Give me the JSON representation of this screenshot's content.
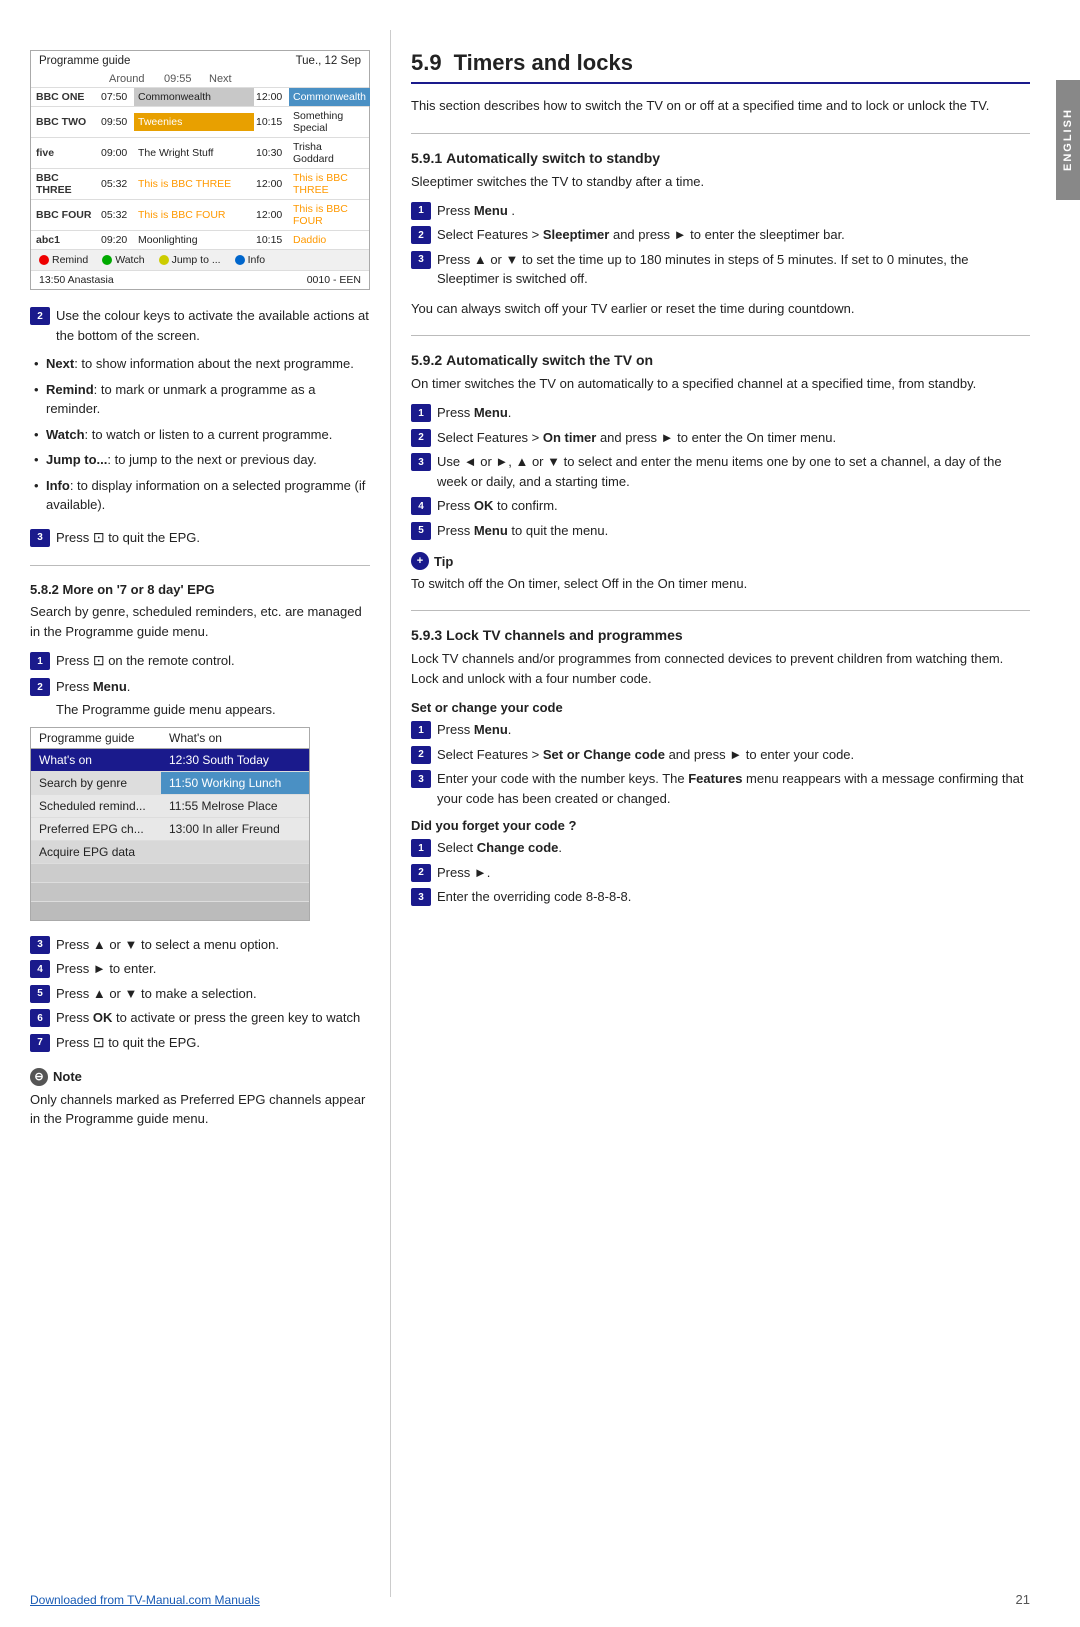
{
  "side_tab": "ENGLISH",
  "left": {
    "prog_table": {
      "title": "Programme guide",
      "date": "Tue., 12 Sep",
      "col_around": "Around",
      "col_time": "09:55",
      "col_next": "Next",
      "rows": [
        {
          "channel": "BBC ONE",
          "time1": "07:50",
          "prog1": "Commonwealth",
          "time2": "12:00",
          "prog2": "Commonwealth",
          "style": "bbc1 bbc2"
        },
        {
          "channel": "BBC TWO",
          "time1": "09:50",
          "prog1": "Tweenies",
          "time2": "10:15",
          "prog2": "Something Special",
          "style": "orange1 blue2"
        },
        {
          "channel": "five",
          "time1": "09:00",
          "prog1": "The Wright Stuff",
          "time2": "10:30",
          "prog2": "Trisha Goddard",
          "style": ""
        },
        {
          "channel": "BBC THREE",
          "time1": "05:32",
          "prog1": "This is BBC THREE",
          "time2": "12:00",
          "prog2": "This is BBC THREE",
          "style": "orange-text"
        },
        {
          "channel": "BBC FOUR",
          "time1": "05:32",
          "prog1": "This is BBC FOUR",
          "time2": "12:00",
          "prog2": "This is BBC FOUR",
          "style": "orange-text"
        },
        {
          "channel": "abc1",
          "time1": "09:20",
          "prog1": "Moonlighting",
          "time2": "10:15",
          "prog2": "Daddio",
          "style": "abc-text"
        }
      ],
      "footer_items": [
        "Remind",
        "Watch",
        "Jump to ...",
        "Info"
      ],
      "footer_left": "13:50  Anastasia",
      "footer_right": "0010 - EEN"
    },
    "step2_text": "Use the colour keys to activate the available actions at the bottom of the screen.",
    "bullets": [
      {
        "label": "Next",
        "text": ": to show information about the next programme."
      },
      {
        "label": "Remind",
        "text": ": to mark or unmark a programme as a reminder."
      },
      {
        "label": "Watch",
        "text": ": to watch or listen to a current programme."
      },
      {
        "label": "Jump to...",
        "text": ": to jump to the next or previous day."
      },
      {
        "label": "Info",
        "text": ": to display information on a selected programme (if available)."
      }
    ],
    "step3_text": "Press ",
    "step3_icon": "⊡",
    "step3_suffix": " to quit the EPG.",
    "subsec_title": "5.8.2    More on '7 or 8 day' EPG",
    "subsec_intro": "Search by genre, scheduled reminders, etc. are managed in the Programme guide menu.",
    "sub_step1": "Press ",
    "sub_step1_icon": "⊡",
    "sub_step1_suffix": " on the remote control.",
    "sub_step2": "Press ",
    "sub_step2_bold": "Menu",
    "sub_step2_suffix": ".",
    "sub_step2_sub": "The Programme guide menu appears.",
    "menu_table": {
      "col1": "Programme guide",
      "col2": "What's on",
      "rows": [
        {
          "col1": "What's on",
          "col2": "12:30 South Today",
          "style": "selected"
        },
        {
          "col1": "Search by genre",
          "col2": "11:50 Working Lunch",
          "style": "highlighted"
        },
        {
          "col1": "Scheduled remind...",
          "col2": "11:55 Melrose Place",
          "style": "plain"
        },
        {
          "col1": "Preferred EPG ch...",
          "col2": "13:00 In aller Freund",
          "style": "plain"
        },
        {
          "col1": "Acquire EPG data",
          "col2": "",
          "style": "gray"
        },
        {
          "col1": "",
          "col2": "",
          "style": "empty"
        },
        {
          "col1": "",
          "col2": "",
          "style": "empty"
        },
        {
          "col1": "",
          "col2": "",
          "style": "empty"
        }
      ]
    },
    "sub_steps_bottom": [
      {
        "num": "3",
        "text": "Press ▲ or ▼ to select a menu option."
      },
      {
        "num": "4",
        "text": "Press ► to enter."
      },
      {
        "num": "5",
        "text": "Press ▲ or ▼ to make a selection."
      },
      {
        "num": "6",
        "text": "Press OK to activate or press the green key to watch"
      },
      {
        "num": "7",
        "text": "Press ",
        "icon": "⊡",
        "suffix": " to quit the EPG."
      }
    ],
    "note_heading": "Note",
    "note_text": "Only channels marked as Preferred EPG channels appear in the Programme guide menu."
  },
  "right": {
    "section_num": "5.9",
    "section_title": "Timers and locks",
    "section_intro": "This section describes how to switch the TV on or off at a specified time and to lock or unlock the TV.",
    "sub591": {
      "num": "5.9.1",
      "title": "Automatically switch to standby",
      "intro": "Sleeptimer switches the TV to standby after a time.",
      "steps": [
        {
          "num": "1",
          "text": "Press ",
          "bold": "Menu",
          "suffix": " ."
        },
        {
          "num": "2",
          "text": "Select Features > ",
          "bold": "Sleeptimer",
          "suffix": " and press ► to enter the sleeptimer bar."
        },
        {
          "num": "3",
          "text": "Press ▲ or ▼ to set the time up to 180 minutes in steps of 5 minutes. If set to 0 minutes, the Sleeptimer is switched off."
        }
      ],
      "para2": "You can always switch off your TV earlier or reset the time during countdown."
    },
    "sub592": {
      "num": "5.9.2",
      "title": "Automatically switch the TV on",
      "intro": "On timer switches the TV on automatically to a specified channel at a specified time, from standby.",
      "steps": [
        {
          "num": "1",
          "text": "Press ",
          "bold": "Menu",
          "suffix": "."
        },
        {
          "num": "2",
          "text": "Select Features > ",
          "bold": "On timer",
          "suffix": " and press ► to enter the On timer menu."
        },
        {
          "num": "3",
          "text": "Use ◄ or ►, ▲ or ▼ to select and enter the menu items one by one to set a channel, a day of the week or daily, and a starting time."
        },
        {
          "num": "4",
          "text": "Press ",
          "bold": "OK",
          "suffix": " to confirm."
        },
        {
          "num": "5",
          "text": "Press ",
          "bold": "Menu",
          "suffix": " to quit the menu."
        }
      ],
      "tip_heading": "Tip",
      "tip_text": "To switch off the On timer, select Off in the On timer menu."
    },
    "sub593": {
      "num": "5.9.3",
      "title": "Lock TV channels and programmes",
      "intro": "Lock TV channels and/or programmes from connected devices to prevent children from watching them. Lock and unlock with a four number code.",
      "set_change_heading": "Set or change your code",
      "set_steps": [
        {
          "num": "1",
          "text": "Press ",
          "bold": "Menu",
          "suffix": "."
        },
        {
          "num": "2",
          "text": "Select Features > ",
          "bold": "Set or Change code",
          "suffix": " and press ► to enter your code."
        },
        {
          "num": "3",
          "text": "Enter your code with the number keys. The ",
          "bold": "Features",
          "suffix": " menu reappears with a message confirming that your code has been created or changed."
        }
      ],
      "forgot_heading": "Did you forget your code ?",
      "forgot_steps": [
        {
          "num": "1",
          "text": "Select ",
          "bold": "Change code",
          "suffix": "."
        },
        {
          "num": "2",
          "text": "Press ►."
        },
        {
          "num": "3",
          "text": "Enter the overriding code 8-8-8-8."
        }
      ]
    }
  },
  "footer": {
    "link_text": "Downloaded from TV-Manual.com Manuals",
    "page_num": "21"
  }
}
